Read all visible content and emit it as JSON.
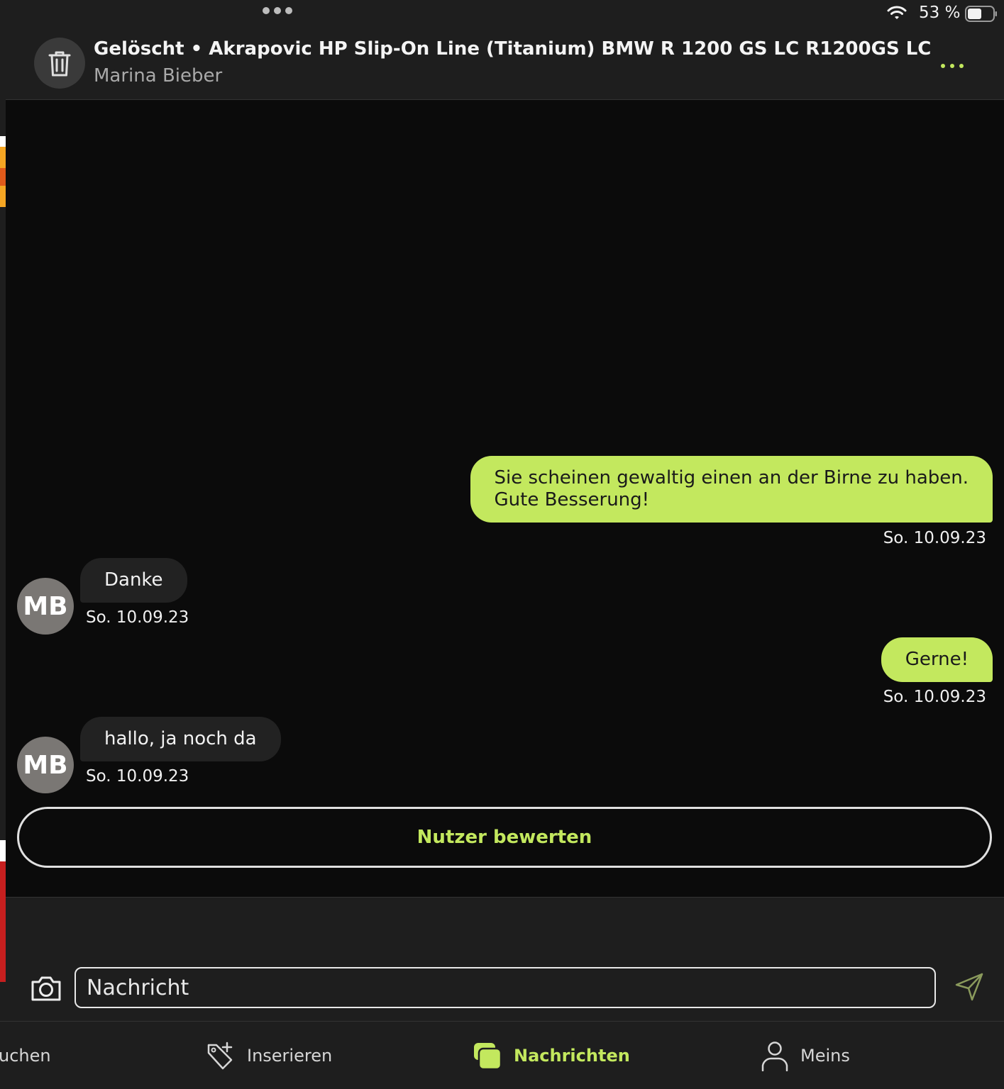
{
  "status_bar": {
    "battery_text": "53 %",
    "icons": [
      "multitask-dots-icon",
      "wifi-icon",
      "battery-icon"
    ]
  },
  "header": {
    "title": "Gelöscht • Akrapovic HP Slip-On Line (Titanium) BMW R 1200 GS LC R1200GS LC",
    "subtitle": "Marina Bieber",
    "thumb_icon": "trash-icon",
    "menu_icon": "more-dots-icon"
  },
  "messages": [
    {
      "direction": "sent",
      "lines": [
        "Sie scheinen gewaltig einen an der Birne zu haben.",
        "Gute Besserung!"
      ],
      "time": "So. 10.09.23"
    },
    {
      "direction": "received",
      "avatar": "MB",
      "text": "Danke",
      "time": "So. 10.09.23"
    },
    {
      "direction": "sent",
      "text": "Gerne!",
      "time": "So. 10.09.23"
    },
    {
      "direction": "received",
      "avatar": "MB",
      "text": "hallo, ja noch da",
      "time": "So. 10.09.23"
    }
  ],
  "rate_button": {
    "label": "Nutzer bewerten"
  },
  "composer": {
    "placeholder": "Nachricht",
    "value": ""
  },
  "tab_bar": {
    "tabs": [
      {
        "label": "uchen",
        "icon": "search-icon",
        "active": false
      },
      {
        "label": "Inserieren",
        "icon": "tag-plus-icon",
        "active": false
      },
      {
        "label": "Nachrichten",
        "icon": "chat-bubbles-icon",
        "active": true
      },
      {
        "label": "Meins",
        "icon": "person-icon",
        "active": false
      }
    ]
  },
  "colors": {
    "accent": "#c3e85e",
    "background": "#0b0b0b",
    "surface": "#1e1e1e",
    "received_bubble": "#222222",
    "avatar": "#7a7774"
  }
}
